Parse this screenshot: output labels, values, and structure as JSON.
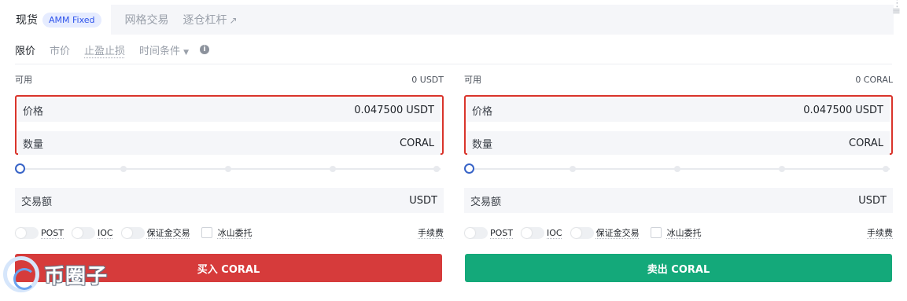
{
  "tabs": {
    "spot": "现货",
    "amm_badge": "AMM Fixed",
    "grid": "网格交易",
    "margin": "逐仓杠杆",
    "margin_arrow": "↗"
  },
  "order_types": {
    "limit": "限价",
    "market": "市价",
    "tp_sl": "止盈止损",
    "time_condition": "时间条件",
    "info": "i"
  },
  "buy_panel": {
    "available_label": "可用",
    "available_value": "0 USDT",
    "price_label": "价格",
    "price_value": "0.047500",
    "price_unit": "USDT",
    "quantity_label": "数量",
    "quantity_unit": "CORAL",
    "amount_label": "交易额",
    "amount_unit": "USDT",
    "slider_percent": 0,
    "opt_post": "POST",
    "opt_ioc": "IOC",
    "opt_margin": "保证金交易",
    "opt_iceberg": "冰山委托",
    "fee": "手续费",
    "button": "买入 CORAL"
  },
  "sell_panel": {
    "available_label": "可用",
    "available_value": "0 CORAL",
    "price_label": "价格",
    "price_value": "0.047500",
    "price_unit": "USDT",
    "quantity_label": "数量",
    "quantity_unit": "CORAL",
    "amount_label": "交易额",
    "amount_unit": "USDT",
    "slider_percent": 0,
    "opt_post": "POST",
    "opt_ioc": "IOC",
    "opt_margin": "保证金交易",
    "opt_iceberg": "冰山委托",
    "fee": "手续费",
    "button": "卖出 CORAL"
  },
  "watermark": {
    "text": "币圈子"
  },
  "colors": {
    "buy": "#d63b3b",
    "sell": "#14a97a",
    "highlight_border": "#d9342b",
    "accent": "#3763c7"
  },
  "icons": {
    "corner": "menu-icon",
    "info": "info-icon",
    "arrow": "external-arrow-icon"
  }
}
